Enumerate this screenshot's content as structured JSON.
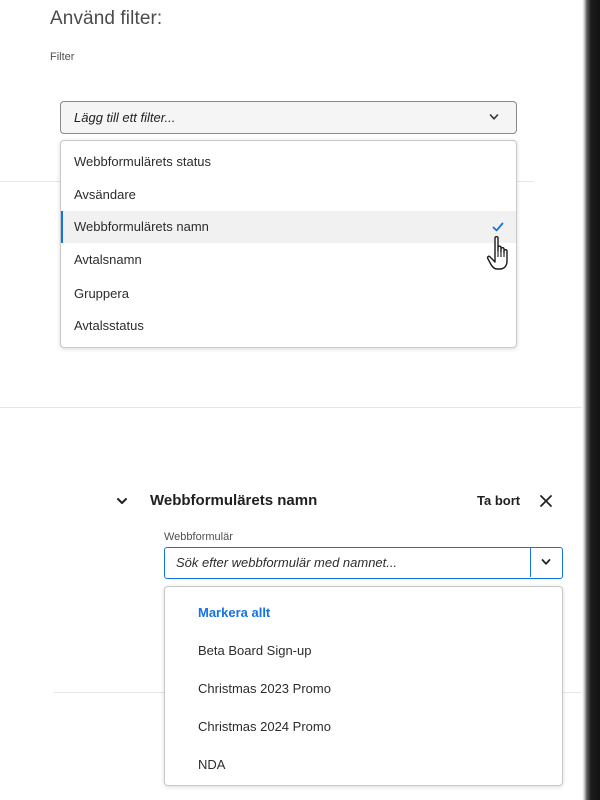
{
  "filter_panel": {
    "title": "Använd filter:",
    "filter_label": "Filter",
    "select_placeholder": "Lägg till ett filter...",
    "options": [
      {
        "label": "Webbformulärets status",
        "selected": false
      },
      {
        "label": "Avsändare",
        "selected": false
      },
      {
        "label": "Webbformulärets namn",
        "selected": true
      },
      {
        "label": "Avtalsnamn",
        "selected": false
      },
      {
        "label": "Gruppera",
        "selected": false
      },
      {
        "label": "Avtalsstatus",
        "selected": false
      }
    ]
  },
  "active_filter": {
    "title": "Webbformulärets namn",
    "remove_label": "Ta bort",
    "field_label": "Webbformulär",
    "search_placeholder": "Sök efter webbformulär med namnet...",
    "select_all_label": "Markera allt",
    "items": [
      "Beta Board Sign-up",
      "Christmas 2023 Promo",
      "Christmas 2024 Promo",
      "NDA"
    ]
  },
  "colors": {
    "accent": "#1473e6",
    "text": "#2c2c2c",
    "selected_row": "#f1f1f1"
  },
  "icons": {
    "dropdown": "chevron-down-icon",
    "check": "checkmark-icon",
    "cursor": "hand-pointer-icon",
    "collapse": "chevron-down-icon",
    "close": "close-icon"
  }
}
